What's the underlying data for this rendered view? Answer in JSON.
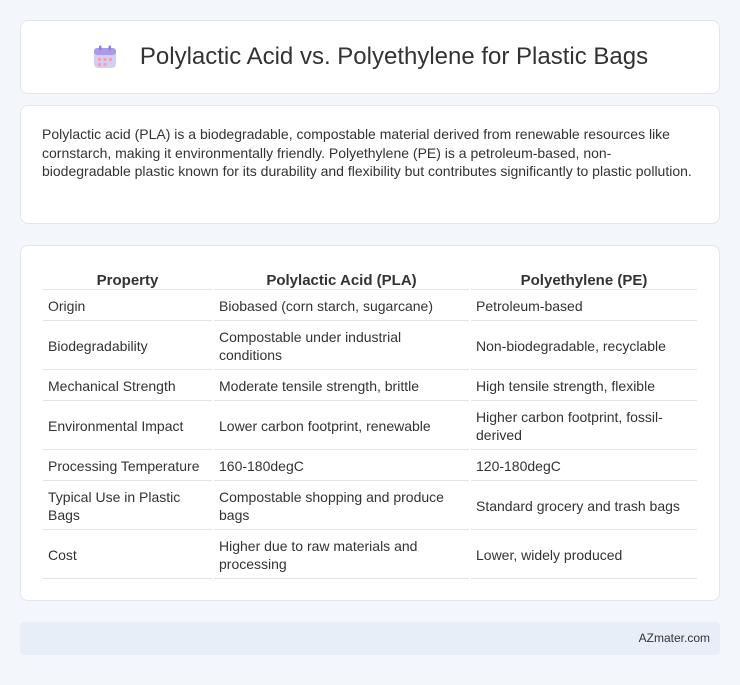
{
  "header": {
    "title": "Polylactic Acid vs. Polyethylene for Plastic Bags",
    "icon": "calendar-icon"
  },
  "intro": {
    "text": "Polylactic acid (PLA) is a biodegradable, compostable material derived from renewable resources like cornstarch, making it environmentally friendly. Polyethylene (PE) is a petroleum-based, non-biodegradable plastic known for its durability and flexibility but contributes significantly to plastic pollution."
  },
  "table": {
    "headers": [
      "Property",
      "Polylactic Acid (PLA)",
      "Polyethylene (PE)"
    ],
    "rows": [
      [
        "Origin",
        "Biobased (corn starch, sugarcane)",
        "Petroleum-based"
      ],
      [
        "Biodegradability",
        "Compostable under industrial conditions",
        "Non-biodegradable, recyclable"
      ],
      [
        "Mechanical Strength",
        "Moderate tensile strength, brittle",
        "High tensile strength, flexible"
      ],
      [
        "Environmental Impact",
        "Lower carbon footprint, renewable",
        "Higher carbon footprint, fossil-derived"
      ],
      [
        "Processing Temperature",
        "160-180degC",
        "120-180degC"
      ],
      [
        "Typical Use in Plastic Bags",
        "Compostable shopping and produce bags",
        "Standard grocery and trash bags"
      ],
      [
        "Cost",
        "Higher due to raw materials and processing",
        "Lower, widely produced"
      ]
    ]
  },
  "footer": {
    "brand": "AZmater.com"
  },
  "colors": {
    "background": "#f3f6fa",
    "footer_bg": "#e8eef7",
    "text": "#333333"
  }
}
